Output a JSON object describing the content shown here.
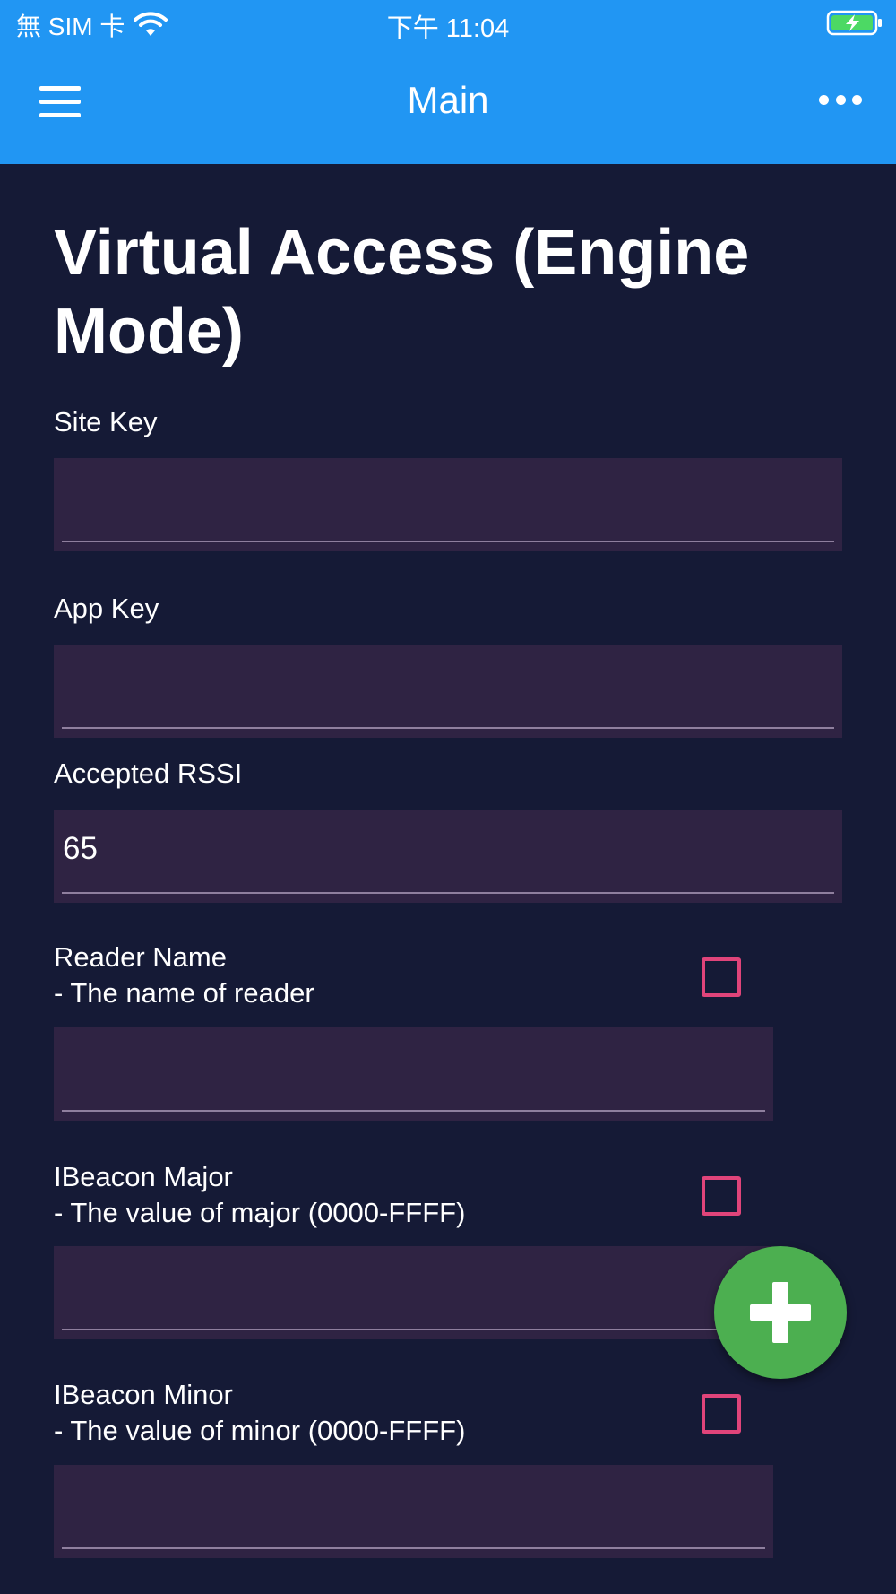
{
  "status_bar": {
    "carrier": "無 SIM 卡",
    "time": "下午 11:04",
    "wifi_icon": "wifi-icon",
    "battery_icon": "battery-charging-icon",
    "battery_color": "#4cd964"
  },
  "app_bar": {
    "title": "Main",
    "menu_icon": "hamburger-menu-icon",
    "more_icon": "more-horizontal-icon",
    "color": "#2196f3"
  },
  "page": {
    "title": "Virtual Access (Engine Mode)",
    "background": "#151a36"
  },
  "fields": [
    {
      "label": "Site Key",
      "value": "",
      "has_checkbox": false
    },
    {
      "label": "App Key",
      "value": "",
      "has_checkbox": false
    },
    {
      "label": "Accepted RSSI",
      "value": "65",
      "has_checkbox": false
    },
    {
      "label": "Reader Name",
      "description": "- The name of reader",
      "value": "",
      "has_checkbox": true,
      "checked": false
    },
    {
      "label": "IBeacon Major",
      "description": "- The value of major (0000-FFFF)",
      "value": "",
      "has_checkbox": true,
      "checked": false
    },
    {
      "label": "IBeacon Minor",
      "description": "- The value of minor (0000-FFFF)",
      "value": "",
      "has_checkbox": true,
      "checked": false
    }
  ],
  "fab": {
    "icon": "plus-icon",
    "color": "#4caf50"
  },
  "accent_colors": {
    "checkbox_border": "#e0447a",
    "input_background": "#2f2343"
  }
}
